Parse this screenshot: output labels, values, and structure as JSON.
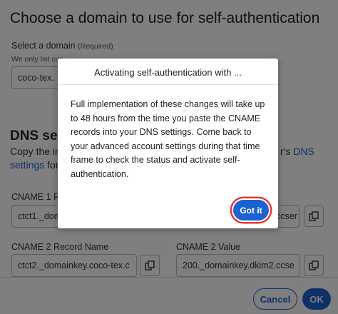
{
  "page": {
    "title": "Choose a domain to use for self-authentication",
    "domain_label": "Select a domain",
    "required_note": "(Required)",
    "domain_hint": "We only list cus",
    "domain_value": "coco-tex.",
    "dns_title": "DNS setti",
    "dns_text_line1": "Copy the in",
    "dns_text_line1_right": "r's",
    "dns_link_right": "DNS",
    "dns_link_line2": "settings",
    "dns_text_line2": "for",
    "cname1_label": "CNAME 1 Reco",
    "cname1_name_value": "ctct1._dom",
    "cname1_value_value": "ccser",
    "cname2_label": "CNAME 2 Record Name",
    "cname2_name_value": "ctct2._domainkey.coco-tex.c",
    "cname2_value_label": "CNAME 2 Value",
    "cname2_value_value": "200._domainkey.dkim2.ccse"
  },
  "footer": {
    "cancel_label": "Cancel",
    "ok_label": "OK"
  },
  "modal": {
    "title": "Activating self-authentication with ...",
    "body": "Full implementation of these changes will take up to 48 hours from the time you paste the CNAME records into your DNS settings. Come back to your advanced account settings during that time frame to check the status and activate self-authentication.",
    "button_label": "Got it"
  },
  "colors": {
    "primary": "#1c62d1",
    "highlight_ring": "#e5382c",
    "overlay": "rgba(0,0,0,0.5)"
  },
  "icons": {
    "copy": "copy-icon"
  }
}
